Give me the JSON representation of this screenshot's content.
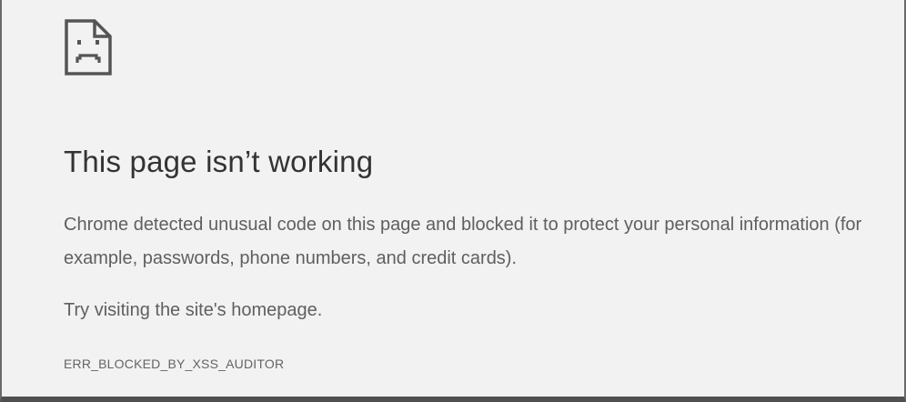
{
  "error_page": {
    "icon": "sad-page-icon",
    "heading": "This page isn’t working",
    "description": "Chrome detected unusual code on this page and blocked it to protect your personal information (for example, passwords, phone numbers, and credit cards).",
    "suggestion": "Try visiting the site's homepage.",
    "error_code": "ERR_BLOCKED_BY_XSS_AUDITOR"
  },
  "colors": {
    "background": "#f2f2f2",
    "heading": "#333333",
    "body_text": "#5f5f5f",
    "icon": "#555555"
  }
}
